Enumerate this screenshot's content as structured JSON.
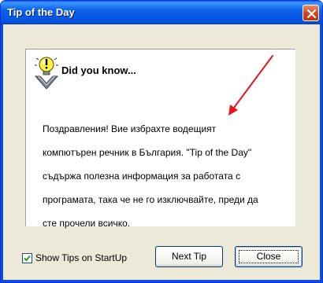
{
  "window": {
    "title": "Tip of the Day",
    "close_icon": "close-x-icon"
  },
  "panel": {
    "icon": "lightbulb-icon",
    "heading": "Did you know...",
    "tip_lines": [
      "Поздравления! Вие избрахте водещият",
      "компютърен речник в България. \"Tip of the Day\"",
      "съдържа полезна информация за работата с",
      "програмата, така че не го изключвайте, преди да",
      "сте прочели всичко."
    ],
    "arrow_color": "#e8141c"
  },
  "footer": {
    "show_tips_label": "Show Tips on StartUp",
    "show_tips_checked": true,
    "next_tip_label": "Next Tip",
    "close_label": "Close"
  }
}
